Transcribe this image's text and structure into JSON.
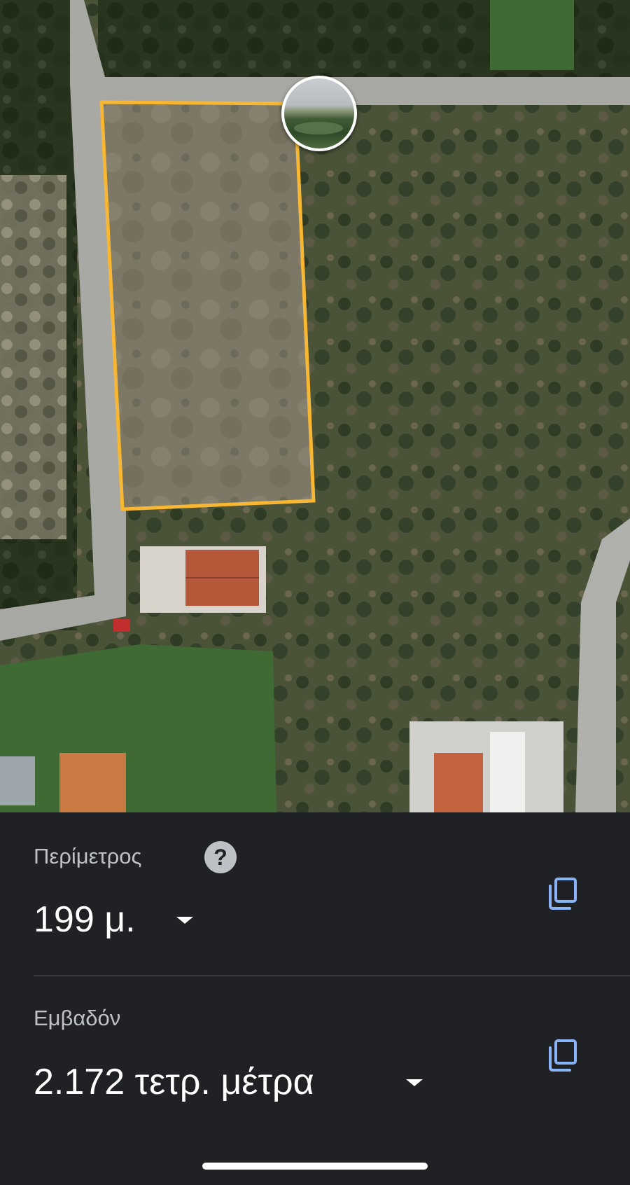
{
  "map": {
    "plot_outline_color": "#f7b733",
    "street_view_icon": "street-view-thumbnail"
  },
  "measurement": {
    "perimeter_label": "Περίμετρος",
    "perimeter_value": "199 μ.",
    "area_label": "Εμβαδόν",
    "area_value": "2.172 τετρ. μέτρα"
  },
  "icons": {
    "help": "?",
    "copy": "copy-icon",
    "dropdown": "caret-down-icon"
  },
  "colors": {
    "sheet_background": "#202124",
    "label_text": "#bdc1c6",
    "value_text": "#ffffff",
    "copy_icon": "#8ab4f8"
  }
}
